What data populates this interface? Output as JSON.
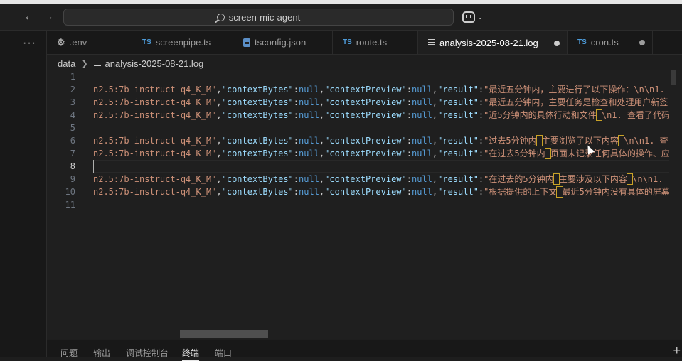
{
  "search": {
    "label": "screen-mic-agent"
  },
  "tabs": [
    {
      "label": ".env",
      "icon": "gear-icon"
    },
    {
      "label": "screenpipe.ts",
      "icon": "TS"
    },
    {
      "label": "tsconfig.json",
      "icon": "json-icon"
    },
    {
      "label": "route.ts",
      "icon": "TS"
    },
    {
      "label": "analysis-2025-08-21.log",
      "icon": "lines-icon",
      "active": true,
      "dirty": true
    },
    {
      "label": "cron.ts",
      "icon": "TS",
      "dirty": true
    }
  ],
  "breadcrumb": {
    "folder": "data",
    "file": "analysis-2025-08-21.log"
  },
  "editor": {
    "line_numbers": [
      "1",
      "2",
      "3",
      "4",
      "5",
      "6",
      "7",
      "8",
      "9",
      "10",
      "11"
    ],
    "frag_model": "n2.5:7b-instruct-q4_K_M\"",
    "k_contextBytes": "\"contextBytes\"",
    "k_contextPreview": "\"contextPreview\"",
    "k_result": "\"result\"",
    "v_null": "null",
    "lines": {
      "l2": "\"最近五分钟内，主要进行了以下操作：\\n\\n1.",
      "l3": "\"最近五分钟内，主要任务是检查和处理用户新签",
      "l4a": "\"近5分钟内的具体行动和文件",
      "l4b": "\\n1. 查看了代码",
      "l6a": "\"过去5分钟内",
      "l6b": "主要浏览了以下内容",
      "l6c": "\\n\\n1. 查",
      "l7a": "\"在过去5分钟内",
      "l7b": "页面未记录任何具体的操作、应",
      "l9a": "\"在过去的5分钟内",
      "l9b": "主要涉及以下内容",
      "l9c": "\\n\\n1.",
      "l10a": "\"根据提供的上下文",
      "l10b": "最近5分钟内没有具体的屏幕"
    }
  },
  "panel": {
    "tabs": [
      "问题",
      "输出",
      "调试控制台",
      "终端",
      "端口"
    ],
    "active": "终端"
  },
  "colors": {
    "accent": "#0078d4",
    "string": "#ce9178",
    "key": "#9cdcfe",
    "keyword": "#569cd6"
  }
}
